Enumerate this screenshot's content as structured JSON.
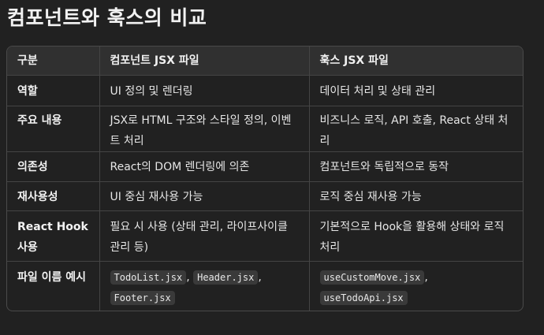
{
  "title": "컴포넌트와 훅스의 비교",
  "table": {
    "headers": [
      "구분",
      "컴포넌트 JSX 파일",
      "훅스 JSX 파일"
    ],
    "rows": [
      {
        "label": "역할",
        "component": "UI 정의 및 렌더링",
        "hooks": "데이터 처리 및 상태 관리"
      },
      {
        "label": "주요 내용",
        "component": "JSX로 HTML 구조와 스타일 정의, 이벤트 처리",
        "hooks": "비즈니스 로직, API 호출, React 상태 처리"
      },
      {
        "label": "의존성",
        "component": "React의 DOM 렌더링에 의존",
        "hooks": "컴포넌트와 독립적으로 동작"
      },
      {
        "label": "재사용성",
        "component": "UI 중심 재사용 가능",
        "hooks": "로직 중심 재사용 가능"
      },
      {
        "label": "React Hook 사용",
        "component": "필요 시 사용 (상태 관리, 라이프사이클 관리 등)",
        "hooks": "기본적으로 Hook을 활용해 상태와 로직 처리"
      },
      {
        "label": "파일 이름 예시",
        "component_files": [
          "TodoList.jsx",
          "Header.jsx",
          "Footer.jsx"
        ],
        "hooks_files": [
          "useCustomMove.jsx",
          "useTodoApi.jsx"
        ]
      }
    ],
    "separator": ","
  }
}
